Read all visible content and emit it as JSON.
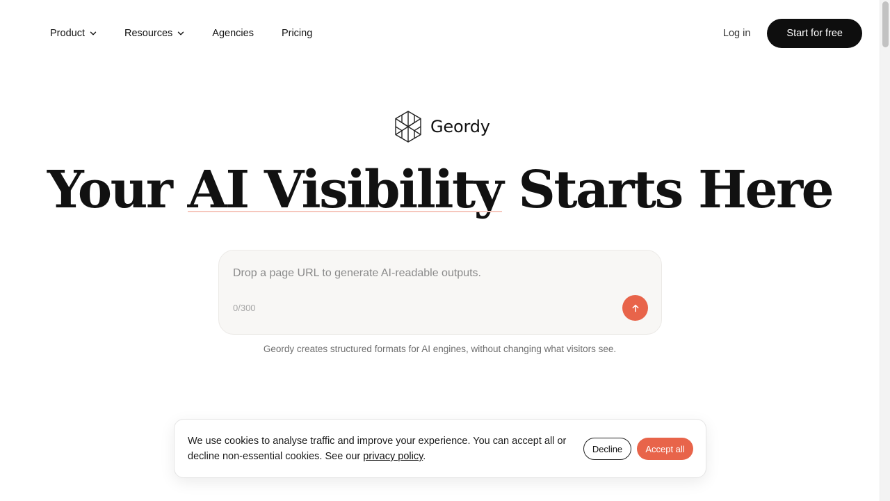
{
  "nav": {
    "items": [
      {
        "label": "Product",
        "has_dropdown": true
      },
      {
        "label": "Resources",
        "has_dropdown": true
      },
      {
        "label": "Agencies",
        "has_dropdown": false
      },
      {
        "label": "Pricing",
        "has_dropdown": false
      }
    ],
    "login_label": "Log in",
    "cta_label": "Start for free"
  },
  "brand": {
    "name": "Geordy",
    "logo_icon": "geordy-hex-logo-icon"
  },
  "hero": {
    "headline_part1": "Your ",
    "headline_highlight": "AI Visibility",
    "headline_part2": " Starts Here"
  },
  "url_form": {
    "placeholder": "Drop a page URL to generate AI-readable outputs.",
    "value": "",
    "counter": "0/300",
    "submit_icon": "arrow-up-icon",
    "helper_text": "Geordy creates structured formats for AI engines, without changing what visitors see."
  },
  "cookie_banner": {
    "text_before_link": "We use cookies to analyse traffic and improve your experience. You can accept all or decline non-essential cookies. See our ",
    "link_label": "privacy policy",
    "text_after_link": ".",
    "decline_label": "Decline",
    "accept_label": "Accept all"
  },
  "colors": {
    "accent": "#e8644a",
    "cta_bg": "#0e0e0e",
    "highlight_underline": "#f6c7bd",
    "input_bg": "#f8f7f5"
  }
}
